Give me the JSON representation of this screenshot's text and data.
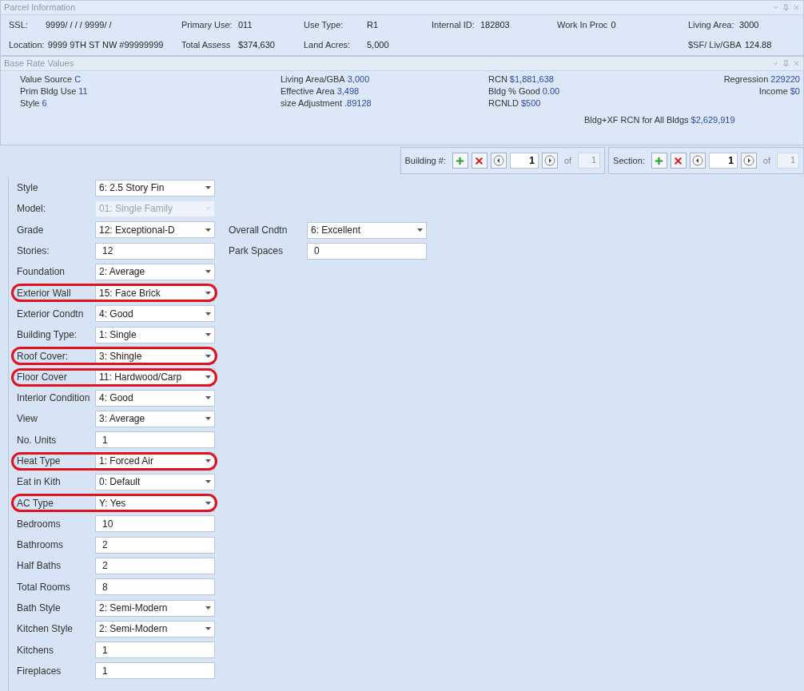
{
  "parcel_panel": {
    "title": "Parcel Information",
    "rows": [
      [
        {
          "label": "SSL:",
          "value": "9999/ /    / / 9999/ /"
        },
        {
          "label": "Primary Use:",
          "value": "011"
        },
        {
          "label": "Use Type:",
          "value": "R1"
        },
        {
          "label": "Internal ID:",
          "value": "182803"
        },
        {
          "label": "Work In Proc",
          "value": "0"
        },
        {
          "label": "Living Area:",
          "value": "3000"
        }
      ],
      [
        {
          "label": "Location:",
          "value": "9999 9TH ST NW #99999999"
        },
        {
          "label": "Total Assess",
          "value": "$374,630"
        },
        {
          "label": "Land Acres:",
          "value": "5,000"
        },
        null,
        null,
        {
          "label": "$SF/ Liv/GBA",
          "value": "124.88"
        }
      ]
    ]
  },
  "base_rate_panel": {
    "title": "Base Rate Values",
    "columns": [
      [
        {
          "label": "Value Source",
          "value": "C"
        },
        {
          "label": "Prim Bldg Use",
          "value": "11"
        },
        {
          "label": "Style",
          "value": "6"
        }
      ],
      [
        {
          "label": "Living Area/GBA",
          "value": "3,000"
        },
        {
          "label": "Effective Area",
          "value": "3,498"
        },
        {
          "label": "size Adjustment",
          "value": ".89128"
        }
      ],
      [
        {
          "label": "RCN",
          "value": "$1,881,638"
        },
        {
          "label": "Bldg % Good",
          "value": "0.00"
        },
        {
          "label": "RCNLD",
          "value": "$500"
        },
        {
          "label": "Bldg+XF RCN for All Bldgs",
          "value": "$2,629,919"
        }
      ],
      [
        {
          "label": "Regression",
          "value": "229220"
        },
        {
          "label": "Income",
          "value": "$0"
        }
      ]
    ]
  },
  "navigators": [
    {
      "label": "Building #:",
      "index": "1",
      "of": "of",
      "total": "1"
    },
    {
      "label": "Section:",
      "index": "1",
      "of": "of",
      "total": "1"
    }
  ],
  "fields": [
    {
      "label": "Style",
      "kind": "select",
      "value": "6: 2.5 Story Fin",
      "disabled": false,
      "highlighted": false
    },
    {
      "label": "Model:",
      "kind": "select",
      "value": "01: Single Family",
      "disabled": true,
      "highlighted": false
    },
    {
      "label": "Grade",
      "kind": "select",
      "value": "12: Exceptional-D",
      "disabled": false,
      "highlighted": false
    },
    {
      "label": "Stories:",
      "kind": "text",
      "value": "12",
      "disabled": false,
      "highlighted": false
    },
    {
      "label": "Foundation",
      "kind": "select",
      "value": "2: Average",
      "disabled": false,
      "highlighted": false
    },
    {
      "label": "Exterior Wall",
      "kind": "select",
      "value": "15: Face Brick",
      "disabled": false,
      "highlighted": true
    },
    {
      "label": "Exterior Condtn",
      "kind": "select",
      "value": "4: Good",
      "disabled": false,
      "highlighted": false
    },
    {
      "label": "Building Type:",
      "kind": "select",
      "value": "1: Single",
      "disabled": false,
      "highlighted": false
    },
    {
      "label": "Roof Cover:",
      "kind": "select",
      "value": "3: Shingle",
      "disabled": false,
      "highlighted": true
    },
    {
      "label": "Floor Cover",
      "kind": "select",
      "value": "11: Hardwood/Carp",
      "disabled": false,
      "highlighted": true
    },
    {
      "label": "Interior Condition",
      "kind": "select",
      "value": "4: Good",
      "disabled": false,
      "highlighted": false
    },
    {
      "label": "View",
      "kind": "select",
      "value": "3: Average",
      "disabled": false,
      "highlighted": false
    },
    {
      "label": "No. Units",
      "kind": "text",
      "value": "1",
      "disabled": false,
      "highlighted": false
    },
    {
      "label": "Heat Type",
      "kind": "select",
      "value": "1: Forced Air",
      "disabled": false,
      "highlighted": true
    },
    {
      "label": "Eat in Kith",
      "kind": "select",
      "value": "0: Default",
      "disabled": false,
      "highlighted": false
    },
    {
      "label": "AC Type",
      "kind": "select",
      "value": "Y: Yes",
      "disabled": false,
      "highlighted": true
    },
    {
      "label": "Bedrooms",
      "kind": "text",
      "value": "10",
      "disabled": false,
      "highlighted": false
    },
    {
      "label": "Bathrooms",
      "kind": "text",
      "value": "2",
      "disabled": false,
      "highlighted": false
    },
    {
      "label": "Half Baths",
      "kind": "text",
      "value": "2",
      "disabled": false,
      "highlighted": false
    },
    {
      "label": "Total Rooms",
      "kind": "text",
      "value": "8",
      "disabled": false,
      "highlighted": false
    },
    {
      "label": "Bath Style",
      "kind": "select",
      "value": "2: Semi-Modern",
      "disabled": false,
      "highlighted": false
    },
    {
      "label": "Kitchen Style",
      "kind": "select",
      "value": "2: Semi-Modern",
      "disabled": false,
      "highlighted": false
    },
    {
      "label": "Kitchens",
      "kind": "text",
      "value": "1",
      "disabled": false,
      "highlighted": false
    },
    {
      "label": "Fireplaces",
      "kind": "text",
      "value": "1",
      "disabled": false,
      "highlighted": false
    }
  ],
  "right_fields": [
    {
      "label": "Overall Cndtn",
      "kind": "select",
      "value": "6: Excellent",
      "disabled": false,
      "highlighted": false
    },
    {
      "label": "Park Spaces",
      "kind": "text",
      "value": "0",
      "disabled": false,
      "highlighted": false
    }
  ]
}
